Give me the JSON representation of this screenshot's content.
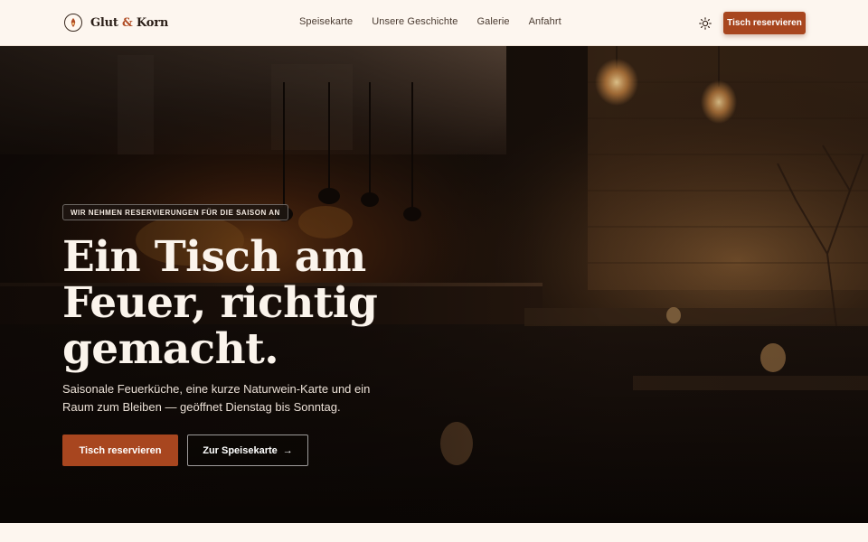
{
  "brand": {
    "name_first": "Glut",
    "name_amp": "&",
    "name_last": "Korn",
    "logo_icon": "flame-compass-icon"
  },
  "nav": {
    "links": [
      "Speisekarte",
      "Unsere Geschichte",
      "Galerie",
      "Anfahrt"
    ],
    "theme_icon": "sun-icon",
    "cta_label": "Tisch reservieren"
  },
  "hero": {
    "badge": "WIR NEHMEN RESERVIERUNGEN FÜR DIE SAISON AN",
    "headline": "Ein Tisch am Feuer, richtig gemacht.",
    "subline": "Saisonale Feuerküche, eine kurze Naturwein-Karte und ein Raum zum Bleiben — geöffnet Dienstag bis Sonntag.",
    "primary_cta": "Tisch reservieren",
    "secondary_cta": "Zur Speisekarte",
    "secondary_icon": "arrow-right-icon",
    "background": "restaurant-interior-photo"
  },
  "colors": {
    "accent": "#a8461f",
    "background": "#fdf6ef",
    "text": "#2a1e17"
  }
}
